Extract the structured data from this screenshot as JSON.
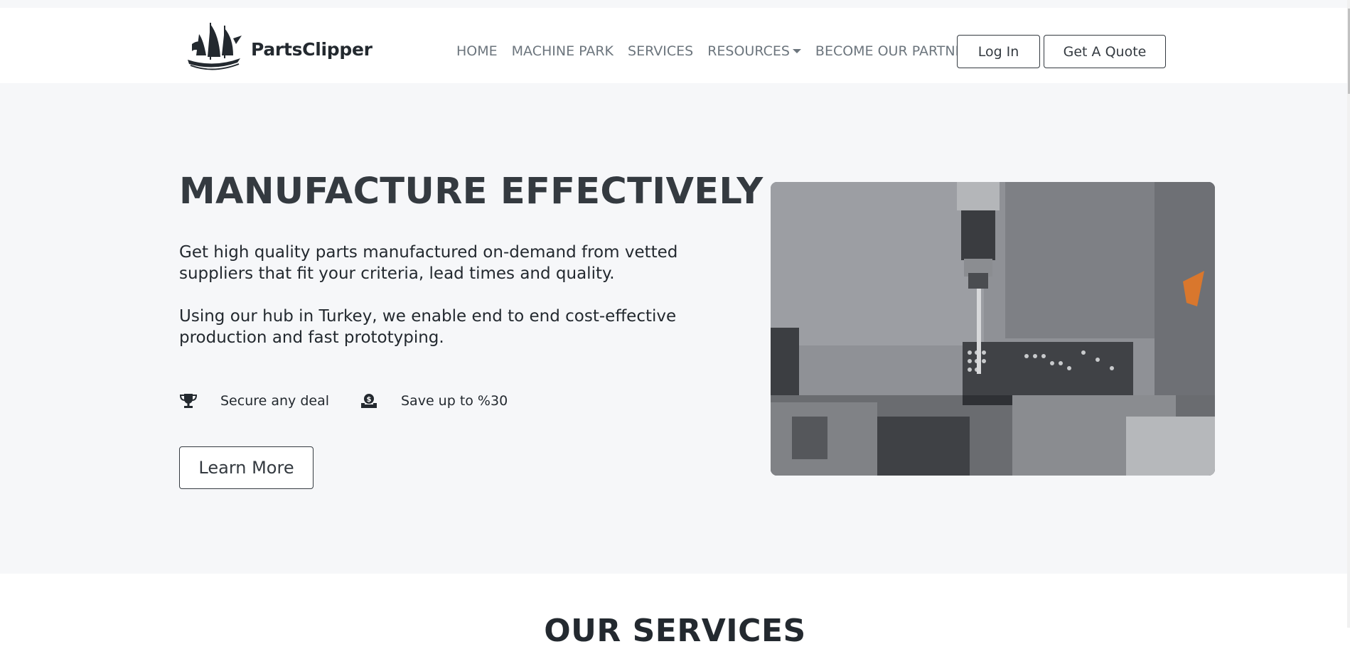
{
  "brand": {
    "name": "PartsClipper",
    "logo": "sailing-ship-logo"
  },
  "nav": {
    "items": [
      {
        "label": "HOME"
      },
      {
        "label": "MACHINE PARK"
      },
      {
        "label": "SERVICES"
      },
      {
        "label": "RESOURCES",
        "dropdown": true
      },
      {
        "label": "BECOME OUR PARTNER"
      }
    ],
    "login_label": "Log In",
    "quote_label": "Get A Quote"
  },
  "hero": {
    "title": "MANUFACTURE EFFECTIVELY",
    "paragraph1": "Get high quality parts manufactured on-demand from vetted suppliers that fit your criteria, lead times and quality.",
    "paragraph2": "Using our hub in Turkey, we enable end to end cost-effective production and fast prototyping.",
    "features": [
      {
        "icon": "trophy-icon",
        "label": "Secure any deal"
      },
      {
        "icon": "money-hand-icon",
        "label": "Save up to %30"
      }
    ],
    "cta_label": "Learn More",
    "image": "cnc-drilling-machine-photo"
  },
  "services": {
    "title": "OUR SERVICES"
  },
  "colors": {
    "hero_bg": "#f6f7f9",
    "text_dark": "#343a40",
    "nav_text": "#6c757d"
  }
}
